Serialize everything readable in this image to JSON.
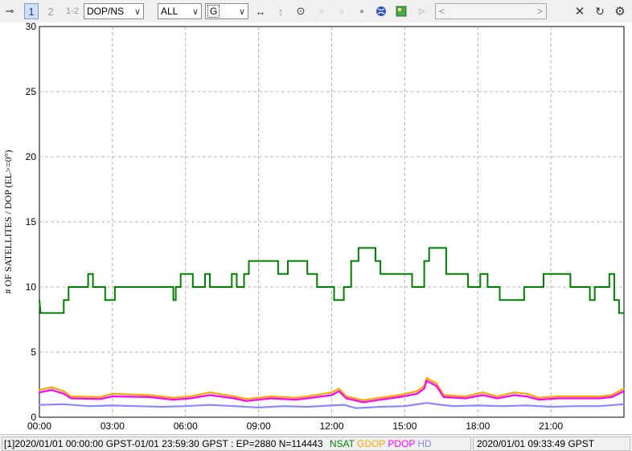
{
  "toolbar": {
    "plot_index_buttons": [
      "1",
      "2",
      "1-2"
    ],
    "plot_type": "DOP/NS",
    "sat_filter": "ALL",
    "system": "G",
    "nav_arrows": [
      "<",
      ">"
    ],
    "colors": {
      "accent": "#1a3d7a",
      "nsat_icon": "#2f55c8",
      "map_icon": "#4aa84a"
    }
  },
  "chart_data": {
    "type": "line",
    "ylabel": "# OF SATELLITES / DOP (EL>=0°)",
    "xlabel": "",
    "ylim": [
      0,
      30
    ],
    "xlim_hours": [
      0,
      24
    ],
    "yticks": [
      "0",
      "5",
      "10",
      "15",
      "20",
      "25",
      "30"
    ],
    "xticks": [
      "00:00",
      "03:00",
      "06:00",
      "09:00",
      "12:00",
      "15:00",
      "18:00",
      "21:00"
    ],
    "grid": true,
    "series": [
      {
        "name": "NSAT",
        "color": "#008000",
        "points": [
          [
            0,
            9
          ],
          [
            0.05,
            8
          ],
          [
            1,
            8
          ],
          [
            1,
            9
          ],
          [
            1.2,
            9
          ],
          [
            1.2,
            10
          ],
          [
            1.6,
            10
          ],
          [
            1.6,
            10
          ],
          [
            2,
            10
          ],
          [
            2,
            11
          ],
          [
            2.2,
            11
          ],
          [
            2.2,
            10
          ],
          [
            2.7,
            10
          ],
          [
            2.7,
            9
          ],
          [
            3.1,
            9
          ],
          [
            3.1,
            10
          ],
          [
            5.5,
            10
          ],
          [
            5.5,
            9
          ],
          [
            5.6,
            9
          ],
          [
            5.6,
            10
          ],
          [
            5.8,
            10
          ],
          [
            5.8,
            11
          ],
          [
            6.3,
            11
          ],
          [
            6.3,
            10
          ],
          [
            6.8,
            10
          ],
          [
            6.8,
            11
          ],
          [
            7,
            11
          ],
          [
            7,
            10
          ],
          [
            7.9,
            10
          ],
          [
            7.9,
            11
          ],
          [
            8.1,
            11
          ],
          [
            8.1,
            10
          ],
          [
            8.4,
            10
          ],
          [
            8.4,
            11
          ],
          [
            8.6,
            11
          ],
          [
            8.6,
            12
          ],
          [
            9.8,
            12
          ],
          [
            9.8,
            11
          ],
          [
            10.2,
            11
          ],
          [
            10.2,
            12
          ],
          [
            11,
            12
          ],
          [
            11,
            11
          ],
          [
            11.4,
            11
          ],
          [
            11.4,
            10
          ],
          [
            12.1,
            10
          ],
          [
            12.1,
            9
          ],
          [
            12.5,
            9
          ],
          [
            12.5,
            10
          ],
          [
            12.8,
            10
          ],
          [
            12.8,
            12
          ],
          [
            13.1,
            12
          ],
          [
            13.1,
            13
          ],
          [
            13.8,
            13
          ],
          [
            13.8,
            12
          ],
          [
            14,
            12
          ],
          [
            14,
            11
          ],
          [
            15.3,
            11
          ],
          [
            15.3,
            10
          ],
          [
            15.8,
            10
          ],
          [
            15.8,
            12
          ],
          [
            16,
            12
          ],
          [
            16,
            13
          ],
          [
            16.7,
            13
          ],
          [
            16.7,
            11
          ],
          [
            17.6,
            11
          ],
          [
            17.6,
            10
          ],
          [
            18.1,
            10
          ],
          [
            18.1,
            11
          ],
          [
            18.4,
            11
          ],
          [
            18.4,
            10
          ],
          [
            18.9,
            10
          ],
          [
            18.9,
            9
          ],
          [
            19.9,
            9
          ],
          [
            19.9,
            10
          ],
          [
            20.7,
            10
          ],
          [
            20.7,
            11
          ],
          [
            21.8,
            11
          ],
          [
            21.8,
            10
          ],
          [
            22.6,
            10
          ],
          [
            22.6,
            9
          ],
          [
            22.8,
            9
          ],
          [
            22.8,
            10
          ],
          [
            23.4,
            10
          ],
          [
            23.4,
            11
          ],
          [
            23.6,
            11
          ],
          [
            23.6,
            9
          ],
          [
            23.8,
            9
          ],
          [
            23.8,
            8
          ],
          [
            24,
            8
          ]
        ]
      },
      {
        "name": "GDOP",
        "color": "#ffa500",
        "points": [
          [
            0,
            2.1
          ],
          [
            0.5,
            2.3
          ],
          [
            1,
            2.0
          ],
          [
            1.3,
            1.6
          ],
          [
            2.5,
            1.55
          ],
          [
            3,
            1.8
          ],
          [
            4.5,
            1.7
          ],
          [
            5.5,
            1.5
          ],
          [
            6.2,
            1.6
          ],
          [
            7,
            1.9
          ],
          [
            8,
            1.6
          ],
          [
            8.5,
            1.4
          ],
          [
            9.5,
            1.6
          ],
          [
            10.5,
            1.5
          ],
          [
            11,
            1.6
          ],
          [
            12,
            1.9
          ],
          [
            12.3,
            2.2
          ],
          [
            12.6,
            1.6
          ],
          [
            13.3,
            1.3
          ],
          [
            14,
            1.5
          ],
          [
            14.8,
            1.7
          ],
          [
            15.5,
            2.0
          ],
          [
            15.8,
            2.4
          ],
          [
            15.9,
            3.0
          ],
          [
            16.3,
            2.6
          ],
          [
            16.6,
            1.7
          ],
          [
            17.5,
            1.6
          ],
          [
            18.2,
            1.9
          ],
          [
            18.8,
            1.6
          ],
          [
            19.5,
            1.9
          ],
          [
            20,
            1.8
          ],
          [
            20.5,
            1.5
          ],
          [
            21.3,
            1.6
          ],
          [
            22,
            1.6
          ],
          [
            23,
            1.6
          ],
          [
            23.5,
            1.7
          ],
          [
            24,
            2.2
          ]
        ]
      },
      {
        "name": "PDOP",
        "color": "#ff00ff",
        "points": [
          [
            0,
            1.9
          ],
          [
            0.5,
            2.1
          ],
          [
            1,
            1.8
          ],
          [
            1.3,
            1.45
          ],
          [
            2.5,
            1.4
          ],
          [
            3,
            1.6
          ],
          [
            4.5,
            1.55
          ],
          [
            5.5,
            1.35
          ],
          [
            6.2,
            1.45
          ],
          [
            7,
            1.7
          ],
          [
            8,
            1.45
          ],
          [
            8.5,
            1.25
          ],
          [
            9.5,
            1.45
          ],
          [
            10.5,
            1.35
          ],
          [
            11,
            1.45
          ],
          [
            12,
            1.7
          ],
          [
            12.3,
            2.0
          ],
          [
            12.6,
            1.45
          ],
          [
            13.3,
            1.15
          ],
          [
            14,
            1.35
          ],
          [
            14.8,
            1.55
          ],
          [
            15.5,
            1.8
          ],
          [
            15.8,
            2.2
          ],
          [
            15.9,
            2.8
          ],
          [
            16.3,
            2.4
          ],
          [
            16.6,
            1.55
          ],
          [
            17.5,
            1.45
          ],
          [
            18.2,
            1.7
          ],
          [
            18.8,
            1.45
          ],
          [
            19.5,
            1.7
          ],
          [
            20,
            1.6
          ],
          [
            20.5,
            1.35
          ],
          [
            21.3,
            1.45
          ],
          [
            22,
            1.45
          ],
          [
            23,
            1.45
          ],
          [
            23.5,
            1.55
          ],
          [
            24,
            2.0
          ]
        ]
      },
      {
        "name": "HDOP",
        "color": "#8888ff",
        "points": [
          [
            0,
            0.95
          ],
          [
            1,
            1.0
          ],
          [
            2,
            0.85
          ],
          [
            3,
            0.9
          ],
          [
            4,
            0.85
          ],
          [
            5,
            0.8
          ],
          [
            6,
            0.85
          ],
          [
            7,
            0.95
          ],
          [
            8,
            0.85
          ],
          [
            9,
            0.75
          ],
          [
            10,
            0.85
          ],
          [
            11,
            0.8
          ],
          [
            12,
            0.9
          ],
          [
            12.5,
            0.95
          ],
          [
            13,
            0.7
          ],
          [
            14,
            0.8
          ],
          [
            15,
            0.85
          ],
          [
            15.9,
            1.1
          ],
          [
            16.5,
            0.95
          ],
          [
            17,
            0.85
          ],
          [
            18,
            0.9
          ],
          [
            19,
            0.85
          ],
          [
            20,
            0.9
          ],
          [
            21,
            0.8
          ],
          [
            22,
            0.85
          ],
          [
            23,
            0.85
          ],
          [
            24,
            1.0
          ]
        ]
      }
    ]
  },
  "status": {
    "summary": "[1]2020/01/01 00:00:00 GPST-01/01 23:59:30 GPST : EP=2880 N=114443",
    "legend": [
      {
        "label": "NSAT",
        "color": "#008000"
      },
      {
        "label": "GDOP",
        "color": "#ffa500"
      },
      {
        "label": "PDOP",
        "color": "#ff00ff"
      },
      {
        "label": "HD",
        "color": "#8888ff"
      }
    ],
    "cursor_time": "2020/01/01 09:33:49 GPST"
  }
}
